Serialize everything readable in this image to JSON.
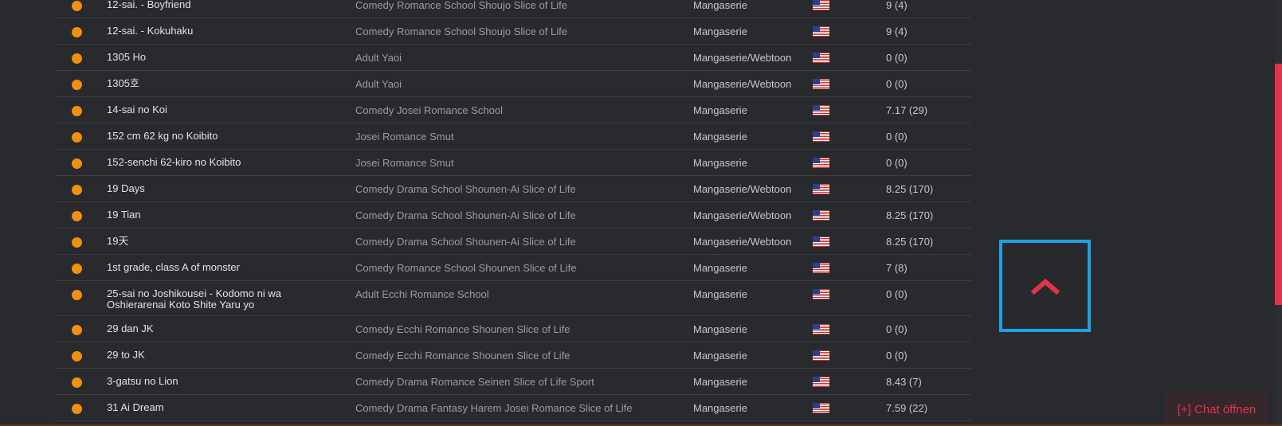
{
  "rows": [
    {
      "title": "12-sai. - Boyfriend",
      "genres": "Comedy Romance School Shoujo Slice of Life",
      "type": "Mangaserie",
      "rating": "9 (4)"
    },
    {
      "title": "12-sai. - Kokuhaku",
      "genres": "Comedy Romance School Shoujo Slice of Life",
      "type": "Mangaserie",
      "rating": "9 (4)"
    },
    {
      "title": "1305 Ho",
      "genres": "Adult Yaoi",
      "type": "Mangaserie/Webtoon",
      "rating": "0 (0)"
    },
    {
      "title": "1305호",
      "genres": "Adult Yaoi",
      "type": "Mangaserie/Webtoon",
      "rating": "0 (0)"
    },
    {
      "title": "14-sai no Koi",
      "genres": "Comedy Josei Romance School",
      "type": "Mangaserie",
      "rating": "7.17 (29)"
    },
    {
      "title": "152 cm 62 kg no Koibito",
      "genres": "Josei Romance Smut",
      "type": "Mangaserie",
      "rating": "0 (0)"
    },
    {
      "title": "152-senchi 62-kiro no Koibito",
      "genres": "Josei Romance Smut",
      "type": "Mangaserie",
      "rating": "0 (0)"
    },
    {
      "title": "19 Days",
      "genres": "Comedy Drama School Shounen-Ai Slice of Life",
      "type": "Mangaserie/Webtoon",
      "rating": "8.25 (170)"
    },
    {
      "title": "19 Tian",
      "genres": "Comedy Drama School Shounen-Ai Slice of Life",
      "type": "Mangaserie/Webtoon",
      "rating": "8.25 (170)"
    },
    {
      "title": "19天",
      "genres": "Comedy Drama School Shounen-Ai Slice of Life",
      "type": "Mangaserie/Webtoon",
      "rating": "8.25 (170)"
    },
    {
      "title": "1st grade, class A of monster",
      "genres": "Comedy Romance School Shounen Slice of Life",
      "type": "Mangaserie",
      "rating": "7 (8)"
    },
    {
      "title": "25-sai no Joshikousei - Kodomo ni wa Oshierarenai Koto Shite Yaru yo",
      "genres": "Adult Ecchi Romance School",
      "type": "Mangaserie",
      "rating": "0 (0)"
    },
    {
      "title": "29 dan JK",
      "genres": "Comedy Ecchi Romance Shounen Slice of Life",
      "type": "Mangaserie",
      "rating": "0 (0)"
    },
    {
      "title": "29 to JK",
      "genres": "Comedy Ecchi Romance Shounen Slice of Life",
      "type": "Mangaserie",
      "rating": "0 (0)"
    },
    {
      "title": "3-gatsu no Lion",
      "genres": "Comedy Drama Romance Seinen Slice of Life Sport",
      "type": "Mangaserie",
      "rating": "8.43 (7)"
    },
    {
      "title": "31 Ai Dream",
      "genres": "Comedy Drama Fantasy Harem Josei Romance Slice of Life",
      "type": "Mangaserie",
      "rating": "7.59 (22)"
    }
  ],
  "chat": {
    "label": "[+] Chat öffnen"
  },
  "icons": {
    "scroll_top": "chevron-up-icon",
    "language": "us-flag-icon"
  },
  "colors": {
    "accent": "#e23448",
    "highlight": "#1ba2e4",
    "status": "#f0900f"
  }
}
